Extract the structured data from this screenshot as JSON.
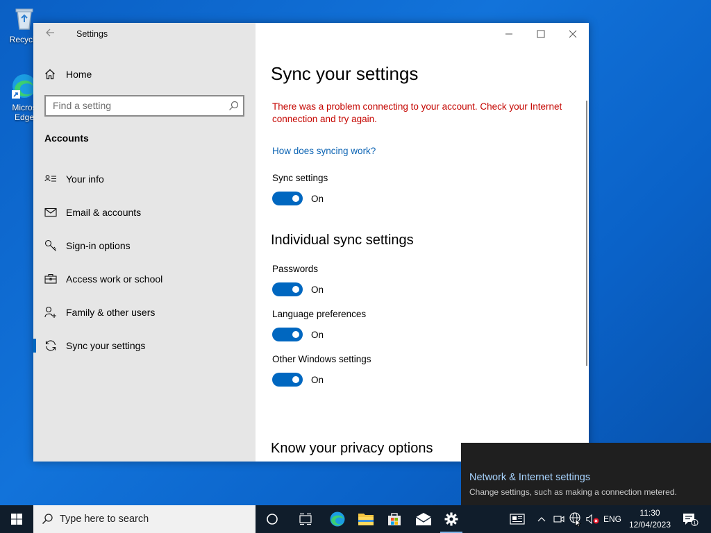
{
  "desktop": {
    "icons": [
      {
        "label": "Recycle",
        "icon": "recycle-bin-icon"
      },
      {
        "label": "Micros Edge",
        "icon": "edge-icon"
      }
    ]
  },
  "window": {
    "title": "Settings",
    "caption": {
      "minimize": "minimize-icon",
      "maximize": "maximize-icon",
      "close": "close-icon"
    }
  },
  "sidebar": {
    "home_label": "Home",
    "search_placeholder": "Find a setting",
    "section_title": "Accounts",
    "items": [
      {
        "label": "Your info",
        "icon": "person-card-icon"
      },
      {
        "label": "Email & accounts",
        "icon": "mail-icon"
      },
      {
        "label": "Sign-in options",
        "icon": "key-icon"
      },
      {
        "label": "Access work or school",
        "icon": "briefcase-icon"
      },
      {
        "label": "Family & other users",
        "icon": "person-add-icon"
      },
      {
        "label": "Sync your settings",
        "icon": "sync-icon",
        "active": true
      }
    ]
  },
  "content": {
    "title": "Sync your settings",
    "error": "There was a problem connecting to your account. Check your Internet connection and try again.",
    "help_link": "How does syncing work?",
    "sync_settings": {
      "label": "Sync settings",
      "state": "On"
    },
    "individual_heading": "Individual sync settings",
    "individual": [
      {
        "label": "Passwords",
        "state": "On"
      },
      {
        "label": "Language preferences",
        "state": "On"
      },
      {
        "label": "Other Windows settings",
        "state": "On"
      }
    ],
    "privacy_heading": "Know your privacy options"
  },
  "toast": {
    "title": "Network & Internet settings",
    "text": "Change settings, such as making a connection metered."
  },
  "taskbar": {
    "search_placeholder": "Type here to search",
    "language": "ENG",
    "time": "11:30",
    "date": "12/04/2023",
    "notification_count": "1"
  },
  "colors": {
    "accent": "#0067c0",
    "error": "#c50500",
    "link": "#0b63b3",
    "taskbar": "#101d2b"
  }
}
